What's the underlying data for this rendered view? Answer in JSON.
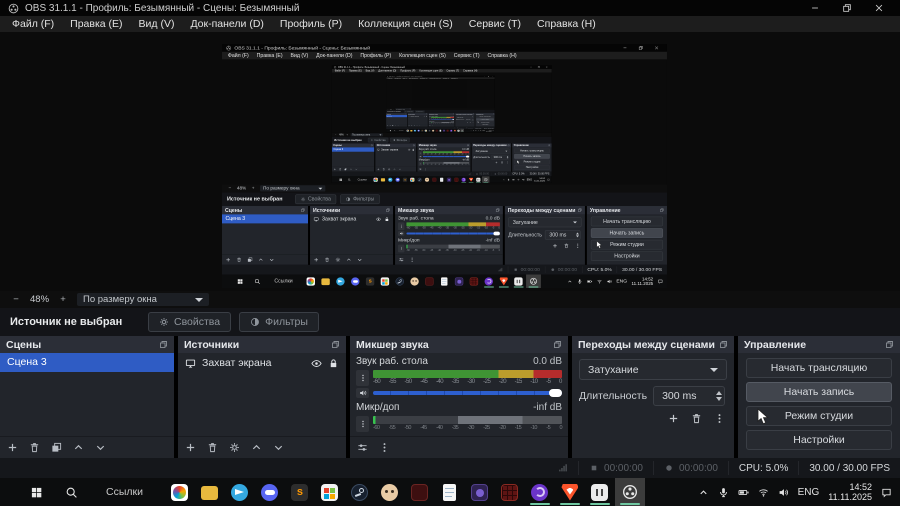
{
  "window": {
    "title": "OBS 31.1.1 - Профиль: Безымянный - Сцены: Безымянный"
  },
  "menu": {
    "items": [
      "Файл (F)",
      "Правка (E)",
      "Вид (V)",
      "Док-панели (D)",
      "Профиль (P)",
      "Коллекция сцен (S)",
      "Сервис (T)",
      "Справка (H)"
    ]
  },
  "zoombar": {
    "minus": "−",
    "level": "48%",
    "plus": "+",
    "fit_mode": "По размеру окна"
  },
  "source_toolbar": {
    "status": "Источник не выбран",
    "properties_label": "Свойства",
    "filters_label": "Фильтры"
  },
  "docks": {
    "scenes": {
      "title": "Сцены",
      "items": [
        {
          "label": "Сцена 3",
          "selected": true
        }
      ]
    },
    "sources": {
      "title": "Источники",
      "items": [
        {
          "label": "Захват экрана"
        }
      ]
    },
    "mixer": {
      "title": "Микшер звука",
      "channels": [
        {
          "name": "Звук раб. стола",
          "level": "0.0 dB"
        },
        {
          "name": "Микр/доп",
          "level": "-inf dB"
        }
      ],
      "ticks": [
        "-60",
        "-55",
        "-50",
        "-45",
        "-40",
        "-35",
        "-30",
        "-25",
        "-20",
        "-15",
        "-10",
        "-5",
        "0"
      ]
    },
    "transitions": {
      "title": "Переходы между сценами",
      "transition": "Затухание",
      "duration_label": "Длительность",
      "duration_value": "300 ms"
    },
    "controls": {
      "title": "Управление",
      "buttons": [
        "Начать трансляцию",
        "Начать запись",
        "Режим студии",
        "Настройки"
      ]
    }
  },
  "statusbar": {
    "stream_time": "00:00:00",
    "record_time": "00:00:00",
    "cpu": "CPU: 5.0%",
    "fps": "30.00 / 30.00 FPS"
  },
  "taskbar": {
    "links_label": "Ссылки",
    "apps": [
      "picpick-icon",
      "folder-icon",
      "telegram-icon",
      "discord-icon",
      "sublime-text-icon",
      "microsoft-store-icon",
      "steam-icon",
      "isaac-game-icon",
      "dark-red-game-icon",
      "notepad-icon",
      "purple-app-icon",
      "red-grid-game-icon",
      "zen-browser-icon",
      "brave-icon",
      "white-app-icon",
      "obs-studio-icon"
    ],
    "running_apps": [
      "zen-browser-icon",
      "brave-icon",
      "white-app-icon",
      "obs-studio-icon"
    ],
    "active_app": "obs-studio-icon",
    "tray": {
      "language": "ENG",
      "time": "14:52",
      "date": "11.11.2025"
    }
  },
  "colors": {
    "selection_blue": "#2f5cc4",
    "volume_slider_blue": "#2d5fcf",
    "meter_green": "#3f9434",
    "meter_yellow": "#bb9c2c",
    "meter_red": "#b52c2c",
    "running_underline_green": "#6fc7a1",
    "panel_header": "#2b2e37",
    "panel_body": "#22252b"
  }
}
